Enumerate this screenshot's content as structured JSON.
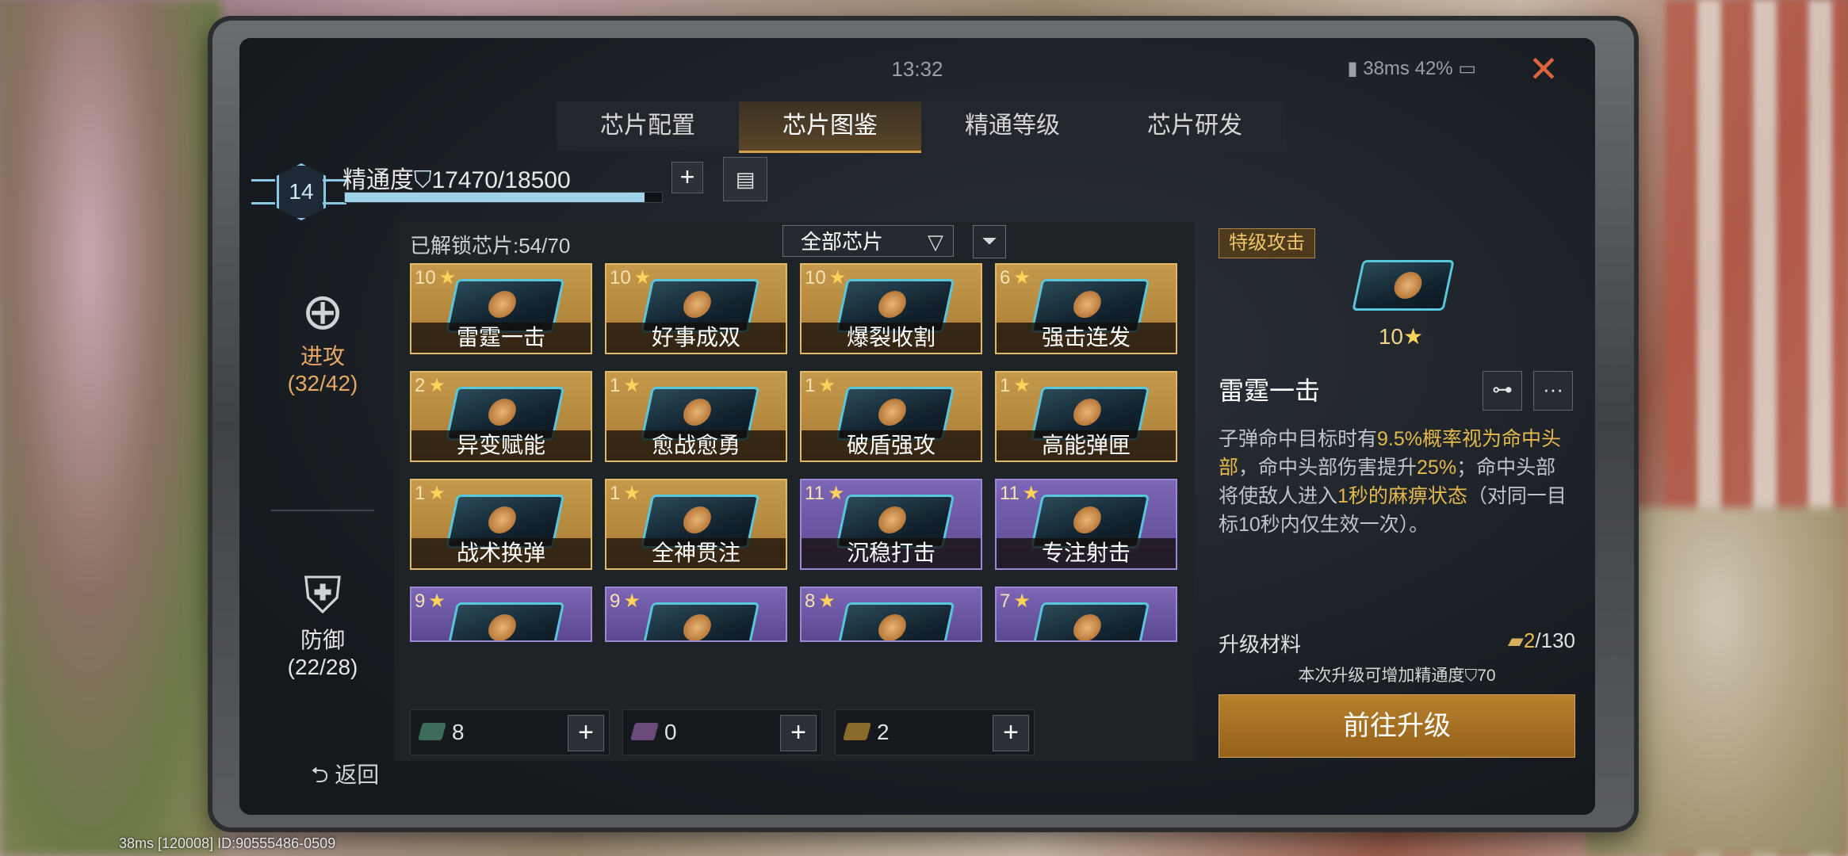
{
  "status": {
    "time": "13:32",
    "ping": "38ms",
    "battery": "42%"
  },
  "tabs": [
    "芯片配置",
    "芯片图鉴",
    "精通等级",
    "芯片研发"
  ],
  "active_tab": 1,
  "mastery": {
    "level": "14",
    "label": "精通度",
    "value": "17470/18500",
    "progress": 0.944
  },
  "sidebar": [
    {
      "label": "进攻",
      "count": "(32/42)"
    },
    {
      "label": "防御",
      "count": "(22/28)"
    }
  ],
  "grid": {
    "unlocked": "已解锁芯片:54/70",
    "filter": "全部芯片",
    "cards": [
      {
        "stars": "10",
        "name": "雷霆一击",
        "tier": "gold"
      },
      {
        "stars": "10",
        "name": "好事成双",
        "tier": "gold"
      },
      {
        "stars": "10",
        "name": "爆裂收割",
        "tier": "gold"
      },
      {
        "stars": "6",
        "name": "强击连发",
        "tier": "gold"
      },
      {
        "stars": "2",
        "name": "异变赋能",
        "tier": "gold"
      },
      {
        "stars": "1",
        "name": "愈战愈勇",
        "tier": "gold"
      },
      {
        "stars": "1",
        "name": "破盾强攻",
        "tier": "gold"
      },
      {
        "stars": "1",
        "name": "高能弹匣",
        "tier": "gold"
      },
      {
        "stars": "1",
        "name": "战术换弹",
        "tier": "gold"
      },
      {
        "stars": "1",
        "name": "全神贯注",
        "tier": "gold"
      },
      {
        "stars": "11",
        "name": "沉稳打击",
        "tier": "purple"
      },
      {
        "stars": "11",
        "name": "专注射击",
        "tier": "purple"
      },
      {
        "stars": "9",
        "name": "",
        "tier": "purple"
      },
      {
        "stars": "9",
        "name": "",
        "tier": "purple"
      },
      {
        "stars": "8",
        "name": "",
        "tier": "purple"
      },
      {
        "stars": "7",
        "name": "",
        "tier": "purple"
      }
    ],
    "resources": [
      "8",
      "0",
      "2"
    ]
  },
  "detail": {
    "type": "特级攻击",
    "stars": "10",
    "title": "雷霆一击",
    "desc_parts": [
      {
        "t": "子弹命中目标时有",
        "hl": false
      },
      {
        "t": "9.5%概率视为命中头部",
        "hl": true
      },
      {
        "t": "，命中头部伤害提升",
        "hl": false
      },
      {
        "t": "25%",
        "hl": true
      },
      {
        "t": "；命中头部将使敌人进入",
        "hl": false
      },
      {
        "t": "1秒的麻痹状态",
        "hl": true
      },
      {
        "t": "（对同一目标10秒内仅生效一次）。",
        "hl": false
      }
    ],
    "mat_label": "升级材料",
    "mat_have": "2",
    "mat_need": "/130",
    "note": "本次升级可增加精通度",
    "note_val": "70",
    "upgrade": "前往升级"
  },
  "back": "返回",
  "corner": "38ms   [120008] ID:90555486-0509",
  "icons": [
    "signal-icon",
    "battery-icon",
    "close-icon",
    "plus-icon",
    "card-icon",
    "attack-icon",
    "defense-icon",
    "funnel-icon",
    "chevron-down-icon",
    "tree-icon",
    "more-icon",
    "back-icon"
  ]
}
